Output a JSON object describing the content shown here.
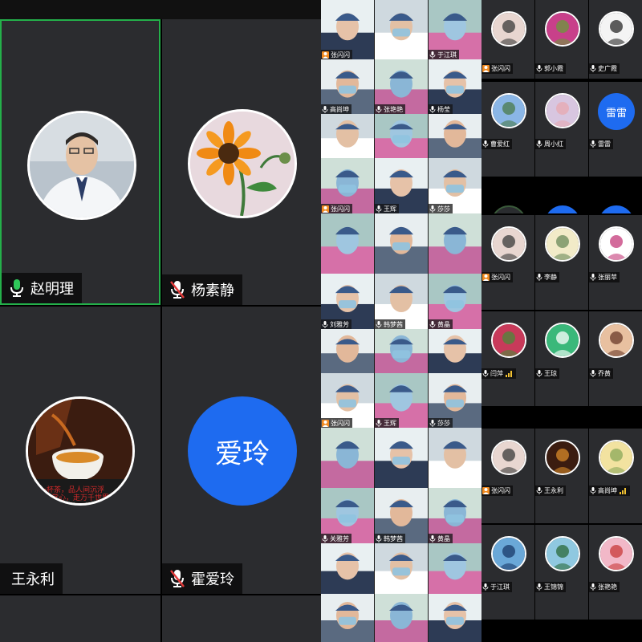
{
  "main_grid": {
    "tiles": [
      {
        "name": "赵明理",
        "mic": "on",
        "avatar": "doctor-photo"
      },
      {
        "name": "杨素静",
        "mic": "muted",
        "avatar": "sunflower-photo"
      },
      {
        "name": "王永利",
        "mic": "none",
        "avatar": "tea-photo"
      },
      {
        "name": "霍爱玲",
        "mic": "muted",
        "avatar_text": "爱玲"
      }
    ]
  },
  "camera_grid": {
    "labels": [
      "张闪闪",
      "",
      "于江琪",
      "高尚坤",
      "张艳艳",
      "杨莹",
      "",
      "",
      "",
      "张闪闪",
      "王辉",
      "莎莎",
      "",
      "",
      "",
      "刘雅芳",
      "韩梦茜",
      "黄晶",
      "",
      "",
      "",
      "张闪闪",
      "王辉",
      "莎莎",
      "",
      "",
      "",
      "关雅芳",
      "韩梦茜",
      "黄晶",
      "",
      "",
      ""
    ]
  },
  "avatar_grid": {
    "labels": [
      "张闪闪",
      "郭小霞",
      "史广霞",
      "曹爱红",
      "周小红",
      "雷雷",
      "张闪闪",
      "李静",
      "张丽苹",
      "闫萍",
      "王琼",
      "乔黄",
      "张闪闪",
      "王永利",
      "高尚坤",
      "于江琪",
      "王锦锦",
      "张艳艳"
    ],
    "blue_avatar_text": "雷雷"
  },
  "colors": {
    "accent_green": "#24b04a",
    "avatar_blue": "#1e6bf0",
    "muted_red": "#e23a3a",
    "host_orange": "#f08a20",
    "tile_bg": "#2b2c2f"
  }
}
